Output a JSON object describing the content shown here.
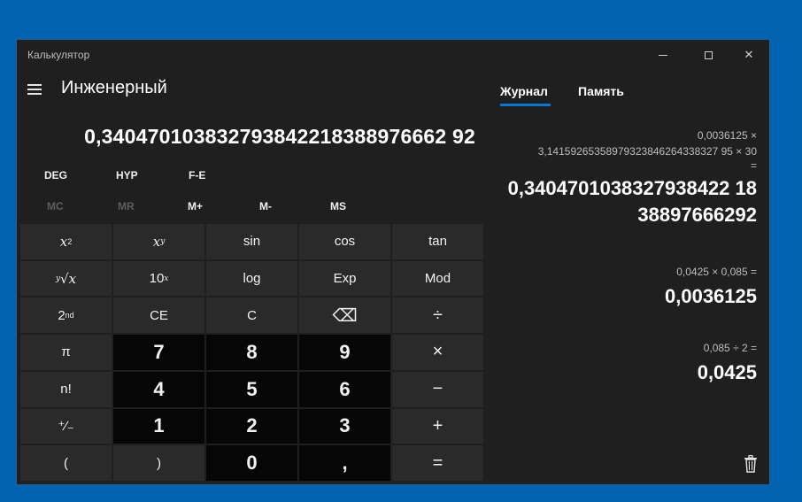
{
  "window": {
    "title": "Калькулятор",
    "controls": {
      "minimize": "minimize-icon",
      "maximize": "maximize-icon",
      "close": "✕"
    }
  },
  "calculator": {
    "mode": "Инженерный",
    "display": "0,340470103832793842218388976662 92",
    "modes": [
      "DEG",
      "HYP",
      "F-E"
    ],
    "memory": [
      "MC",
      "MR",
      "M+",
      "M-",
      "MS"
    ],
    "keys": {
      "x2": "x",
      "x2_sup": "2",
      "xy": "x",
      "xy_sup": "y",
      "sin": "sin",
      "cos": "cos",
      "tan": "tan",
      "root_idx": "y",
      "root_base": "√x",
      "ten": "10",
      "ten_sup": "x",
      "log": "log",
      "exp": "Exp",
      "mod": "Mod",
      "second": "2",
      "second_sup": "nd",
      "ce": "CE",
      "c": "C",
      "backspace": "⌫",
      "divide": "÷",
      "pi": "π",
      "seven": "7",
      "eight": "8",
      "nine": "9",
      "multiply": "×",
      "fact": "n!",
      "four": "4",
      "five": "5",
      "six": "6",
      "minus": "−",
      "negate": "⁺∕₋",
      "one": "1",
      "two": "2",
      "three": "3",
      "plus": "+",
      "lparen": "(",
      "rparen": ")",
      "zero": "0",
      "comma": ",",
      "equals": "="
    }
  },
  "history_panel": {
    "tabs": [
      "Журнал",
      "Память"
    ],
    "entries": [
      {
        "expr_line1": "0,0036125   ×",
        "expr_line2": "3,14159265358979323846264338327 95   ×   30",
        "expr_line3": "=",
        "result_line1": "0,3404701038327938422 18",
        "result_line2": "38897666292"
      },
      {
        "expr": "0,0425   ×   0,085 =",
        "result": "0,0036125"
      },
      {
        "expr": "0,085   ÷   2 =",
        "result": "0,0425"
      }
    ]
  }
}
